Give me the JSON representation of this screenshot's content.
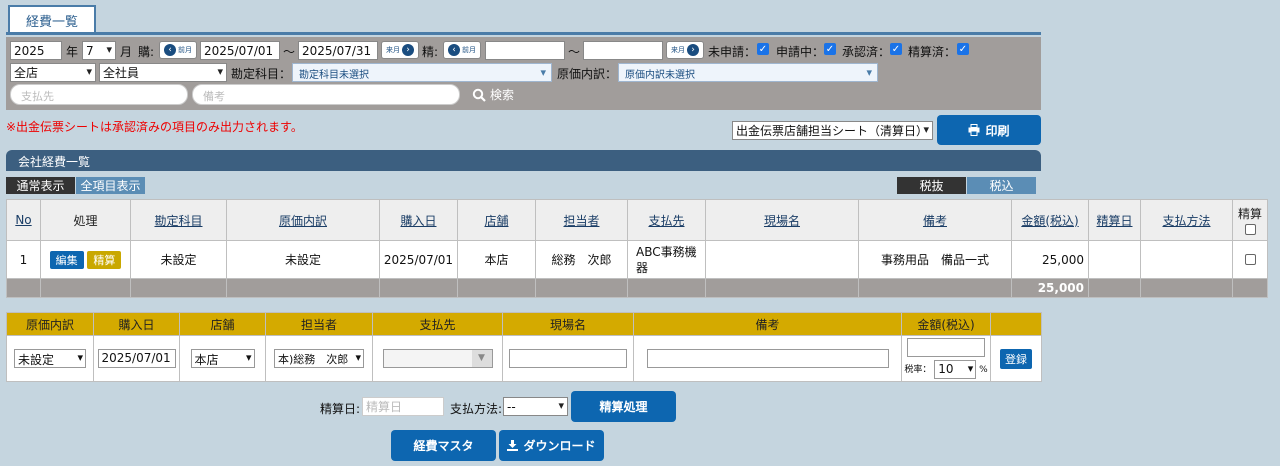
{
  "page": {
    "tab_title": "経費一覧"
  },
  "filters": {
    "year": "2025",
    "year_label": "年",
    "month": "7",
    "month_label": "月",
    "purchase_label": "購:",
    "prev_month": "前月",
    "next_month": "来月",
    "date_from": "2025/07/01",
    "tilde": "〜",
    "date_to": "2025/07/31",
    "settle_label": "精:",
    "settle_from": "",
    "settle_to": "",
    "status": {
      "unapplied": "未申請：",
      "applying": "申請中：",
      "approved": "承認済：",
      "settled": "精算済："
    },
    "store": "全店",
    "staff": "全社員",
    "account_label": "勘定科目：",
    "account_value": "勘定科目未選択",
    "cost_label": "原価内訳：",
    "cost_value": "原価内訳未選択",
    "payee_placeholder": "支払先",
    "memo_placeholder": "備考",
    "search": "検索"
  },
  "notice": "※出金伝票シートは承認済みの項目のみ出力されます。",
  "report_select": "出金伝票店舗担当シート（清算日）",
  "print_button": "印刷",
  "section_title": "会社経費一覧",
  "view_tabs": {
    "normal": "通常表示",
    "all": "全項目表示"
  },
  "tax_tabs": {
    "excl": "税抜",
    "incl": "税込"
  },
  "table": {
    "headers": [
      "No",
      "処理",
      "勘定科目",
      "原価内訳",
      "購入日",
      "店舗",
      "担当者",
      "支払先",
      "現場名",
      "備考",
      "金額(税込)",
      "精算日",
      "支払方法",
      "精算"
    ],
    "rows": [
      {
        "no": "1",
        "edit": "編集",
        "settle": "精算",
        "account": "未設定",
        "cost": "未設定",
        "date": "2025/07/01",
        "store": "本店",
        "staff": "総務　次郎",
        "payee": "ABC事務機器",
        "site": "",
        "memo": "事務用品　備品一式",
        "amount": "25,000",
        "settle_date": "",
        "pay_method": ""
      }
    ],
    "total": "25,000"
  },
  "register": {
    "headers": [
      "原価内訳",
      "購入日",
      "店舗",
      "担当者",
      "支払先",
      "現場名",
      "備考",
      "金額(税込)",
      ""
    ],
    "cost": "未設定",
    "date": "2025/07/01",
    "store": "本店",
    "staff": "本)総務　次郎",
    "tax_label": "税率：",
    "tax_rate": "10",
    "percent": "%",
    "register_button": "登録"
  },
  "settlement": {
    "date_label": "精算日:",
    "date_placeholder": "精算日",
    "method_label": "支払方法:",
    "method_value": "--",
    "process_button": "精算処理"
  },
  "footer_buttons": {
    "master": "経費マスタ",
    "download": "ダウンロード"
  },
  "colors": {
    "accent": "#0d66b0",
    "header_bar": "#3c5f80",
    "gold": "#d4aa00",
    "filter_bg": "#a19d9b"
  }
}
